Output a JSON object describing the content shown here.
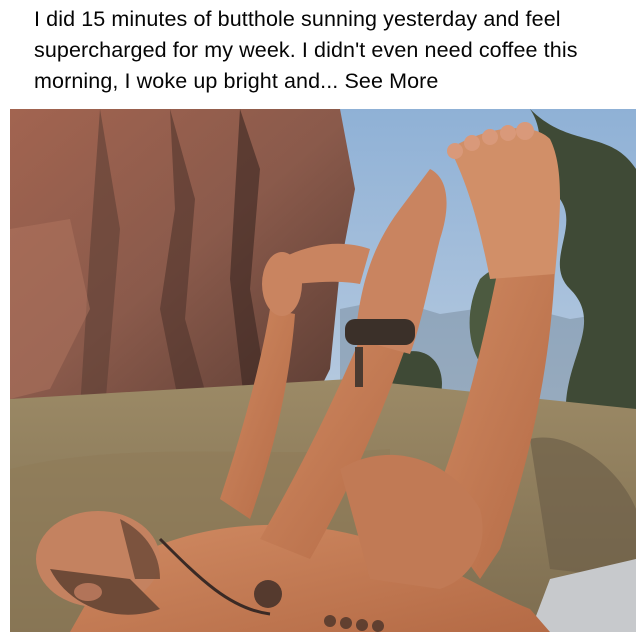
{
  "post": {
    "text": "I did 15 minutes of butthole sunning yesterday and feel supercharged for my week. I didn't even need coffee this morning, I woke up bright and...",
    "see_more_label": "See More"
  },
  "photo": {
    "icon": "photo-icon"
  },
  "colors": {
    "text": "#050505",
    "background": "#ffffff"
  }
}
